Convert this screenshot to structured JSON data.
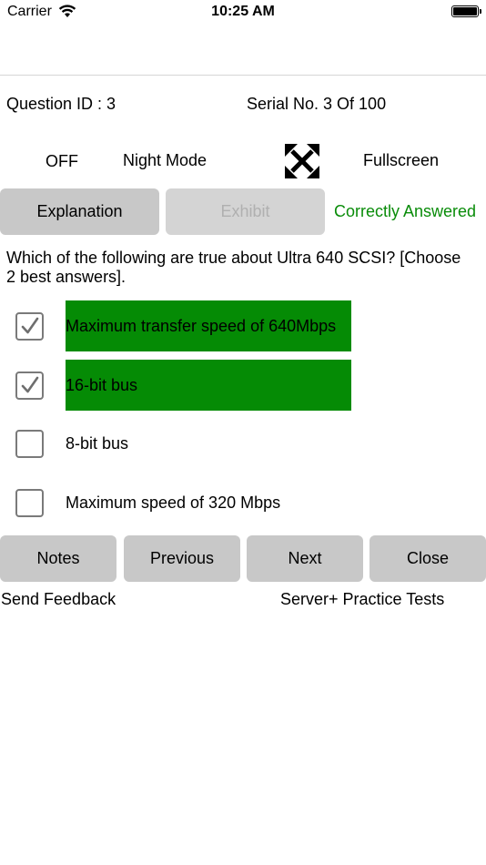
{
  "status_bar": {
    "carrier": "Carrier",
    "time": "10:25 AM"
  },
  "header": {
    "question_id": "Question ID : 3",
    "serial": "Serial No. 3 Of 100"
  },
  "controls": {
    "night_mode_state": "OFF",
    "night_mode_label": "Night Mode",
    "fullscreen_icon": "expand-arrows-icon",
    "fullscreen_label": "Fullscreen"
  },
  "actions": {
    "explanation_label": "Explanation",
    "exhibit_label": "Exhibit",
    "result_text": "Correctly Answered"
  },
  "question": {
    "text": "Which of the following are true about Ultra 640 SCSI? [Choose 2 best answers]."
  },
  "answers": [
    {
      "text": "Maximum transfer speed of 640Mbps",
      "checked": true,
      "correct": true
    },
    {
      "text": "16-bit bus",
      "checked": true,
      "correct": true
    },
    {
      "text": "8-bit bus",
      "checked": false,
      "correct": false
    },
    {
      "text": "Maximum speed of 320 Mbps",
      "checked": false,
      "correct": false
    }
  ],
  "navigation": {
    "notes_label": "Notes",
    "previous_label": "Previous",
    "next_label": "Next",
    "close_label": "Close"
  },
  "footer": {
    "feedback": "Send Feedback",
    "brand": "Server+ Practice Tests"
  },
  "colors": {
    "correct_text": "#098c09",
    "correct_highlight": "#058b05",
    "button_bg": "#c8c8c8"
  }
}
